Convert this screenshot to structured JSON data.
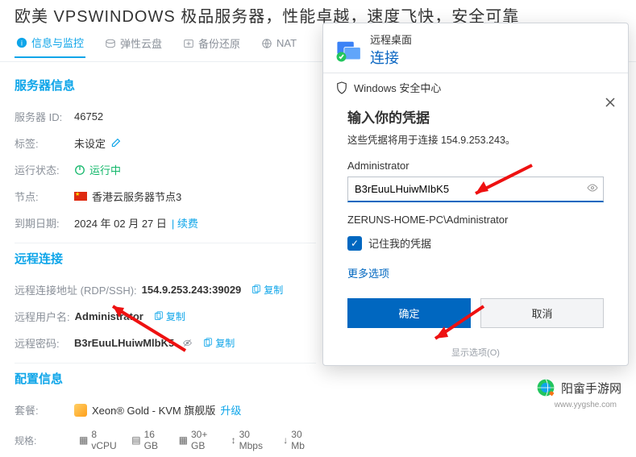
{
  "banner": "欧美 VPSWINDOWS 极品服务器，性能卓越，速度飞快，安全可靠",
  "tabs": {
    "info": "信息与监控",
    "disk": "弹性云盘",
    "backup": "备份还原",
    "nat": "NAT"
  },
  "left": {
    "server_info_title": "服务器信息",
    "server_id_label": "服务器 ID:",
    "server_id": "46752",
    "tag_label": "标签:",
    "tag_value": "未设定",
    "status_label": "运行状态:",
    "status_value": "运行中",
    "node_label": "节点:",
    "node_value": "香港云服务器节点3",
    "expire_label": "到期日期:",
    "expire_value": "2024 年 02 月 27 日",
    "renew": "| 续费",
    "remote_title": "远程连接",
    "addr_label": "远程连接地址 (RDP/SSH):",
    "addr_value": "154.9.253.243:39029",
    "user_label": "远程用户名:",
    "user_value": "Administrator",
    "pass_label": "远程密码:",
    "pass_value": "B3rEuuLHuiwMlbK5",
    "copy": "复制",
    "config_title": "配置信息",
    "plan_label": "套餐:",
    "plan_value": "Xeon® Gold - KVM 旗舰版",
    "upgrade": "升级",
    "spec_label": "规格:",
    "cpu": "8 vCPU",
    "mem": "16 GB",
    "bw1": "30+ GB",
    "bw2": "30 Mbps",
    "bw3": "30 Mb"
  },
  "rdp": {
    "title1": "远程桌面",
    "title2": "连接",
    "security_center": "Windows 安全中心",
    "cred_title": "输入你的凭据",
    "cred_sub": "这些凭据将用于连接 154.9.253.243。",
    "username": "Administrator",
    "password": "B3rEuuLHuiwMIbK5",
    "domain": "ZERUNS-HOME-PC\\Administrator",
    "remember": "记住我的凭据",
    "more": "更多选项",
    "ok": "确定",
    "cancel": "取消",
    "more_sub": "显示选项(O)"
  },
  "footer": {
    "brand": "阳畲手游网",
    "url": "www.yygshe.com"
  }
}
